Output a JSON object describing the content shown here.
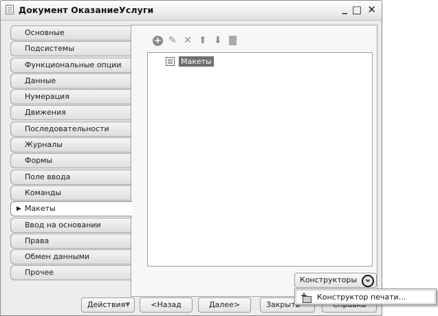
{
  "window": {
    "title": "Документ ОказаниеУслуги",
    "controls": {
      "minimize": "_",
      "maximize": "□",
      "close": "✕"
    }
  },
  "tabs": [
    {
      "label": "Основные",
      "active": false
    },
    {
      "label": "Подсистемы",
      "active": false
    },
    {
      "label": "Функциональные опции",
      "active": false
    },
    {
      "label": "Данные",
      "active": false
    },
    {
      "label": "Нумерация",
      "active": false
    },
    {
      "label": "Движения",
      "active": false
    },
    {
      "label": "Последовательности",
      "active": false
    },
    {
      "label": "Журналы",
      "active": false
    },
    {
      "label": "Формы",
      "active": false
    },
    {
      "label": "Поле ввода",
      "active": false
    },
    {
      "label": "Команды",
      "active": false
    },
    {
      "label": "Макеты",
      "active": true
    },
    {
      "label": "Ввод на основании",
      "active": false
    },
    {
      "label": "Права",
      "active": false
    },
    {
      "label": "Обмен данными",
      "active": false
    },
    {
      "label": "Прочее",
      "active": false
    }
  ],
  "active_marker": "▶",
  "toolbar": {
    "icons": [
      "add-icon",
      "edit-icon",
      "delete-icon",
      "move-up-icon",
      "move-down-icon",
      "document-icon"
    ]
  },
  "tree": {
    "items": [
      {
        "label": "Макеты",
        "selected": true
      }
    ]
  },
  "designers_button": {
    "label": "Конструкторы"
  },
  "popup_menu": {
    "items": [
      {
        "label": "Конструктор печати..."
      }
    ]
  },
  "footer": {
    "actions": "Действия",
    "back": "<Назад",
    "next": "Далее>",
    "close": "Закрыть",
    "help": "Справка"
  }
}
